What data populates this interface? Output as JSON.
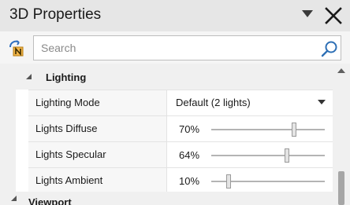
{
  "panel": {
    "title": "3D Properties"
  },
  "search": {
    "placeholder": "Search"
  },
  "section": {
    "title": "Lighting"
  },
  "properties": [
    {
      "label": "Lighting Mode",
      "value": "Default (2 lights)",
      "control": "dropdown"
    },
    {
      "label": "Lights Diffuse",
      "value": "70%",
      "control": "slider",
      "level_percent": 70
    },
    {
      "label": "Lights Specular",
      "value": "64%",
      "control": "slider",
      "level_percent": 64
    },
    {
      "label": "Lights Ambient",
      "value": "10%",
      "control": "slider",
      "level_percent": 10
    }
  ],
  "next_section": {
    "title": "Viewport"
  },
  "icons": {
    "title_dropdown": "chevron-down-icon",
    "close": "close-icon",
    "tool": "toolbox-icon",
    "search": "search-icon"
  }
}
